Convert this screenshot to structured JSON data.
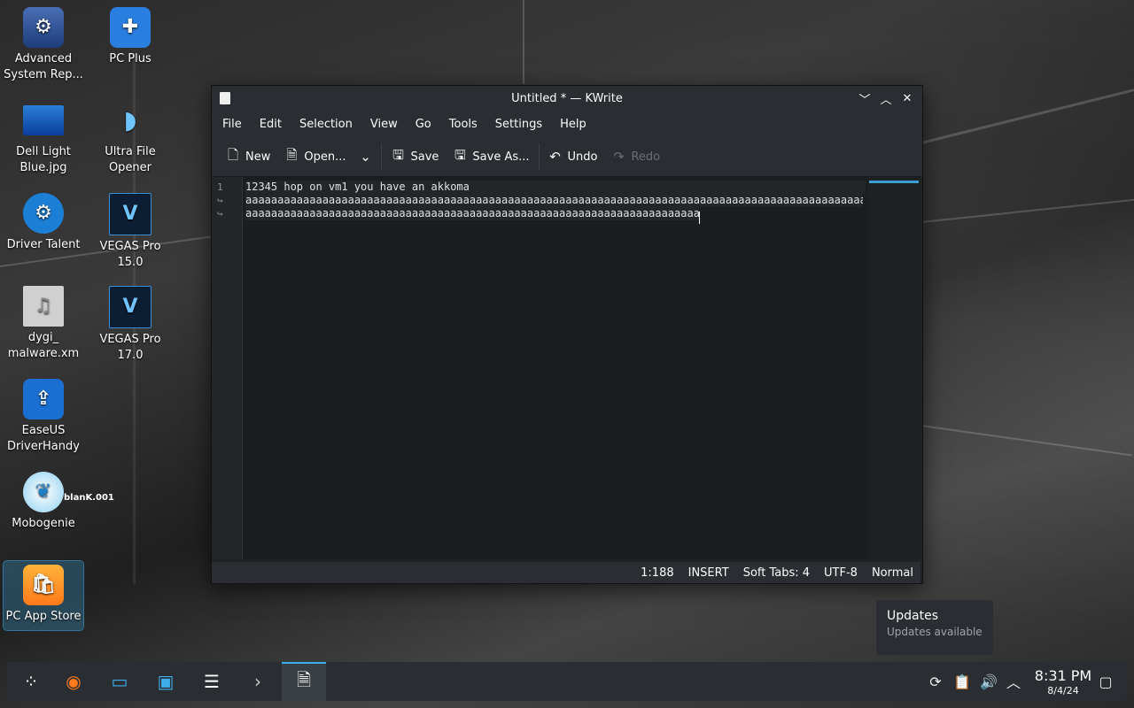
{
  "desktop": {
    "icons": [
      {
        "label": "Advanced System Rep...",
        "icon": "shield-gear-icon"
      },
      {
        "label": "PC Plus",
        "icon": "medical-kit-icon"
      },
      {
        "label": "Dell Light Blue.jpg",
        "icon": "image-file-icon"
      },
      {
        "label": "Ultra File Opener",
        "icon": "saucer-icon"
      },
      {
        "label": "Driver Talent",
        "icon": "gear-icon"
      },
      {
        "label": "VEGAS Pro 15.0",
        "icon": "vegas-v-icon",
        "glyph": "V"
      },
      {
        "label": "dygi_ malware.xm",
        "icon": "audio-file-icon"
      },
      {
        "label": "VEGAS Pro 17.0",
        "icon": "vegas-v-icon",
        "glyph": "V"
      },
      {
        "label": "EaseUS DriverHandy",
        "icon": "upload-gear-icon"
      },
      {
        "label": "Mobogenie",
        "icon": "mobogenie-icon"
      },
      {
        "label": "PC App Store",
        "icon": "shopping-bag-icon"
      }
    ],
    "wallpaper_text": "blanK.001"
  },
  "window": {
    "title": "Untitled * — KWrite",
    "menu": [
      "File",
      "Edit",
      "Selection",
      "View",
      "Go",
      "Tools",
      "Settings",
      "Help"
    ],
    "toolbar": {
      "new": "New",
      "open": "Open...",
      "save": "Save",
      "save_as": "Save As...",
      "undo": "Undo",
      "redo": "Redo"
    },
    "line_numbers": [
      "1",
      "↪",
      "↪"
    ],
    "lines": [
      "12345 hop on vm1 you have an akkoma",
      "aaaaaaaaaaaaaaaaaaaaaaaaaaaaaaaaaaaaaaaaaaaaaaaaaaaaaaaaaaaaaaaaaaaaaaaaaaaaaaaaaaaaaaaaaaaaaaaaaaaaaaaaaaaaaaaaaaaaaaaaaaaaaaaaaaaaaaaaaaaaaaaaaaaaaaaaaaaaaaaaaaaaaaaaaaaaaaaaaaaaaaaaaaaaaaaaaaaaaaaaaaaaaaaaaaaaaaaaaaaaaaaaaaaaaaaaaaa",
      "aaaaaaaaaaaaaaaaaaaaaaaaaaaaaaaaaaaaaaaaaaaaaaaaaaaaaaaaaaaaaaaaaaaaaaaaaaaaa"
    ],
    "status": {
      "position": "1:188",
      "mode": "INSERT",
      "tabs": "Soft Tabs: 4",
      "encoding": "UTF-8",
      "syntax": "Normal"
    }
  },
  "notification": {
    "title": "Updates",
    "subtitle": "Updates available"
  },
  "taskbar": {
    "apps": [
      "app-launcher-icon",
      "firefox-icon",
      "file-manager-icon",
      "discover-store-icon",
      "system-settings-icon",
      "terminal-icon",
      "kwrite-icon"
    ],
    "time": "8:31 PM",
    "date": "8/4/24"
  },
  "colors": {
    "accent": "#3daee9",
    "window_bg": "#202326",
    "taskbar_bg": "#2a2e32"
  }
}
